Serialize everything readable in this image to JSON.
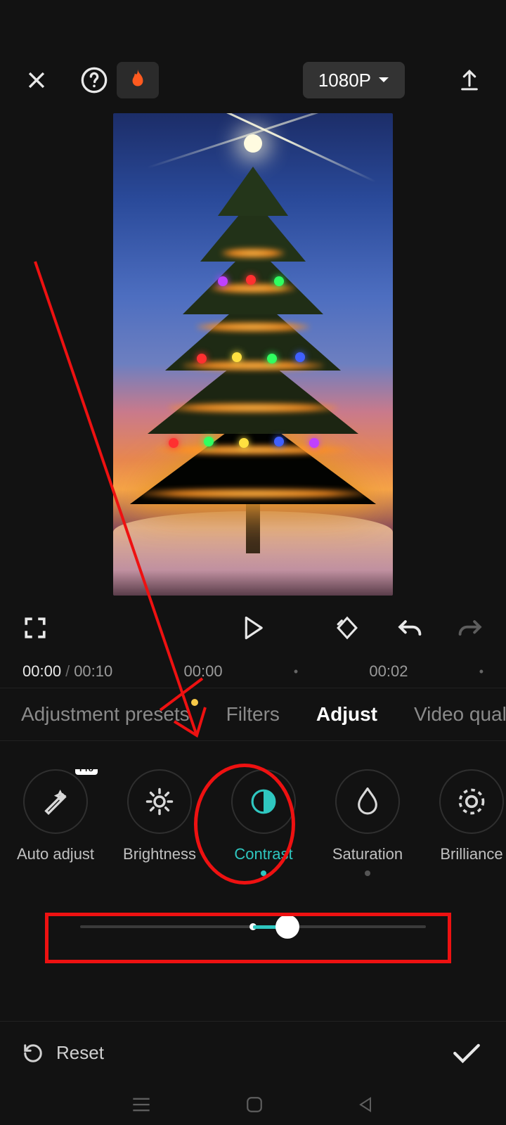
{
  "topbar": {
    "resolution_label": "1080P"
  },
  "timeline": {
    "current": "00:00",
    "total": "00:10",
    "marks": [
      "00:00",
      "00:02"
    ]
  },
  "tabs": [
    {
      "label": "Adjustment presets",
      "active": false,
      "has_dot": true
    },
    {
      "label": "Filters",
      "active": false
    },
    {
      "label": "Adjust",
      "active": true
    },
    {
      "label": "Video quality",
      "active": false
    }
  ],
  "adjust": {
    "items": [
      {
        "label": "Auto adjust",
        "icon": "wand",
        "pro": true
      },
      {
        "label": "Brightness",
        "icon": "sun"
      },
      {
        "label": "Contrast",
        "icon": "contrast",
        "active": true,
        "dot": "active"
      },
      {
        "label": "Saturation",
        "icon": "droplet",
        "dot": "inactive"
      },
      {
        "label": "Brilliance",
        "icon": "sun-ring"
      }
    ],
    "pro_badge": "Pro",
    "slider": {
      "min": -50,
      "max": 50,
      "value": 10,
      "percent": 60
    }
  },
  "footer": {
    "reset_label": "Reset"
  }
}
